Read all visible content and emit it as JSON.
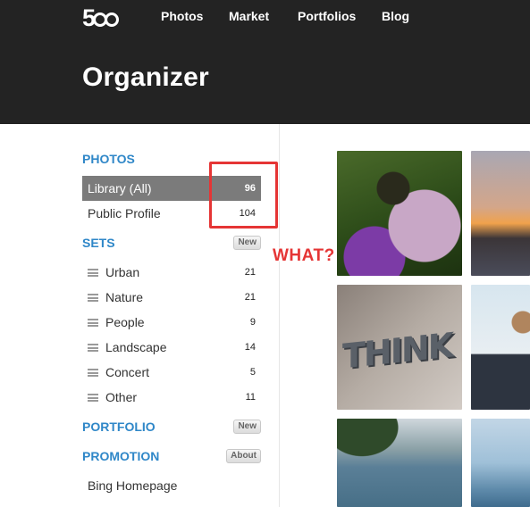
{
  "header": {
    "logo_text": "500",
    "nav": [
      "Photos",
      "Market",
      "Portfolios",
      "Blog"
    ],
    "title": "Organizer",
    "background": "#232323"
  },
  "sidebar": {
    "photos": {
      "heading": "PHOTOS",
      "items": [
        {
          "label": "Library (All)",
          "count": "96",
          "active": true
        },
        {
          "label": "Public Profile",
          "count": "104",
          "active": false
        }
      ]
    },
    "sets": {
      "heading": "SETS",
      "button": "New",
      "items": [
        {
          "label": "Urban",
          "count": "21"
        },
        {
          "label": "Nature",
          "count": "21"
        },
        {
          "label": "People",
          "count": "9"
        },
        {
          "label": "Landscape",
          "count": "14"
        },
        {
          "label": "Concert",
          "count": "5"
        },
        {
          "label": "Other",
          "count": "11"
        }
      ]
    },
    "portfolio": {
      "heading": "PORTFOLIO",
      "button": "New"
    },
    "promotion": {
      "heading": "PROMOTION",
      "button": "About",
      "items": [
        {
          "label": "Bing Homepage"
        }
      ]
    },
    "accent_color": "#2f87c8",
    "active_color": "#7b7b7b"
  },
  "annotation": {
    "text": "WHAT?",
    "color": "#e53535"
  },
  "photos": {
    "think_sign_text": "THINK"
  }
}
